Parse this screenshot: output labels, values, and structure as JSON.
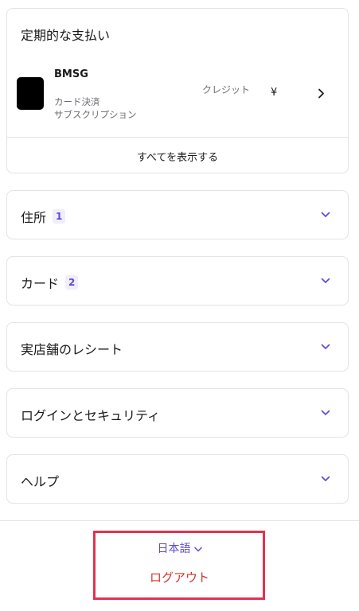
{
  "subscriptions": {
    "title": "定期的な支払い",
    "merchant": {
      "name": "BMSG",
      "line1": "カード決済",
      "line2": "サブスクリプション",
      "method": "クレジット",
      "amount": "¥"
    },
    "show_all": "すべてを表示する"
  },
  "sections": [
    {
      "label": "住所",
      "count": "1"
    },
    {
      "label": "カード",
      "count": "2"
    },
    {
      "label": "実店舗のレシート"
    },
    {
      "label": "ログインとセキュリティ"
    },
    {
      "label": "ヘルプ"
    }
  ],
  "footer": {
    "language": "日本語",
    "logout": "ログアウト"
  },
  "colors": {
    "accent": "#5a4bd1",
    "logout": "#d2322d",
    "highlight": "#e2324f",
    "border": "#e3e3e6"
  },
  "icons": {
    "row_arrow": "chevron-right-icon",
    "expand": "chevron-down-icon"
  }
}
